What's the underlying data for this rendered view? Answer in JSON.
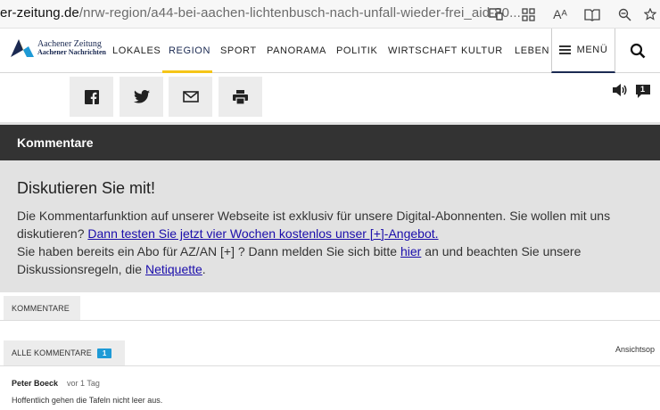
{
  "browser": {
    "url_domain": "er-zeitung.de",
    "url_path": "/nrw-region/a44-bei-aachen-lichtenbusch-nach-unfall-wieder-frei_aid-80...",
    "read_aloud_label": "Aᴬ"
  },
  "site": {
    "logo_line1": "Aachener Zeitung",
    "logo_line2": "Aachener Nachrichten",
    "nav": [
      "LOKALES",
      "REGION",
      "SPORT",
      "PANORAMA",
      "POLITIK",
      "WIRTSCHAFT",
      "KULTUR",
      "LEBEN"
    ],
    "active_nav": "REGION",
    "menu_label": "MENÜ"
  },
  "comment_count_badge": "1",
  "comments_section": {
    "header": "Kommentare",
    "title": "Diskutieren Sie mit!",
    "text1": "Die Kommentarfunktion auf unserer Webseite ist exklusiv für unsere Digital-Abonnenten. Sie wollen mit uns diskutieren? ",
    "link1": "Dann testen Sie jetzt vier Wochen kostenlos unser [+]-Angebot.",
    "text2": "Sie haben bereits ein Abo für AZ/AN [+] ? Dann melden Sie sich bitte ",
    "link2": "hier",
    "text3": " an und beachten Sie unsere Diskussionsregeln, die ",
    "link3": "Netiquette",
    "text4": "."
  },
  "tabs": {
    "kommentare": "KOMMENTARE",
    "alle": "ALLE KOMMENTARE",
    "alle_count": "1",
    "view_options": "Ansichtsop"
  },
  "comments": [
    {
      "author": "Peter Boeck",
      "time": "vor 1 Tag",
      "text": "Hoffentlich gehen die Tafeln nicht leer aus."
    }
  ],
  "colors": {
    "brand": "#1b2a52",
    "accent": "#f5c518",
    "badge": "#1e9ad6"
  }
}
